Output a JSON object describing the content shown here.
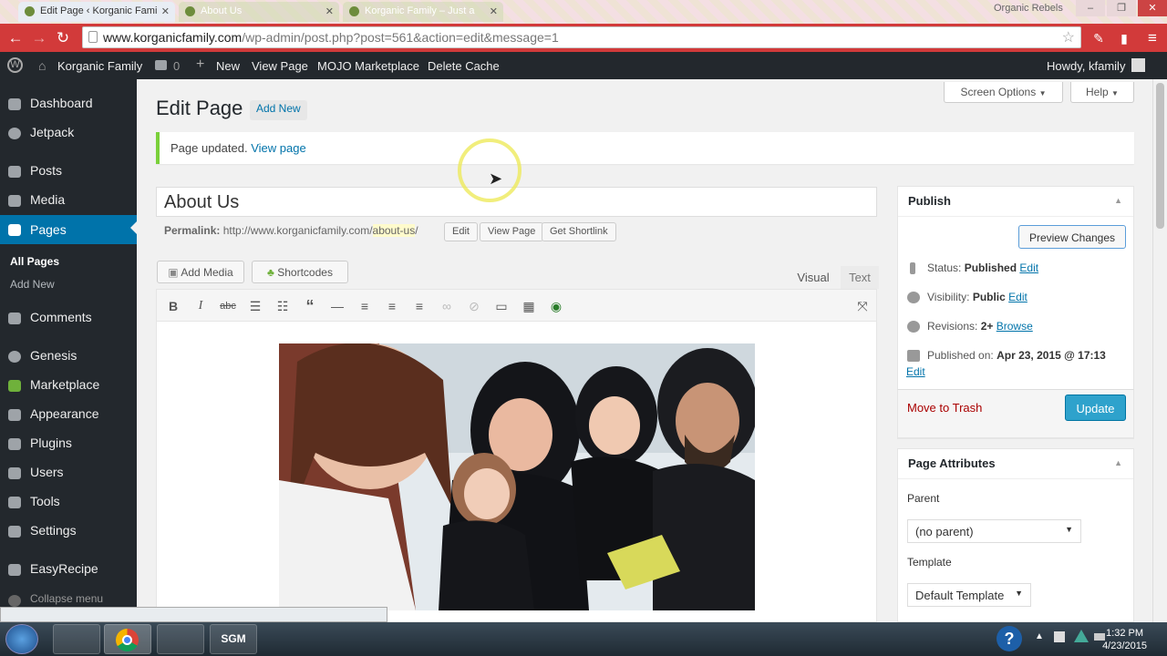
{
  "browser": {
    "tabs": [
      {
        "title": "Edit Page ‹ Korganic Fami",
        "active": true
      },
      {
        "title": "About Us",
        "active": false
      },
      {
        "title": "Korganic Family – Just a",
        "active": false
      }
    ],
    "user_badge": "Organic Rebels",
    "url_host": "www.korganicfamily.com",
    "url_path": "/wp-admin/post.php?post=561&action=edit&message=1"
  },
  "adminbar": {
    "site": "Korganic Family",
    "comments": "0",
    "new": "New",
    "view_page": "View Page",
    "mojo": "MOJO Marketplace",
    "delete_cache": "Delete Cache",
    "howdy": "Howdy, kfamily"
  },
  "sidebar": {
    "items": [
      {
        "label": "Dashboard"
      },
      {
        "label": "Jetpack"
      },
      {
        "label": "Posts"
      },
      {
        "label": "Media"
      },
      {
        "label": "Pages"
      },
      {
        "label": "Comments"
      },
      {
        "label": "Genesis"
      },
      {
        "label": "Marketplace"
      },
      {
        "label": "Appearance"
      },
      {
        "label": "Plugins"
      },
      {
        "label": "Users"
      },
      {
        "label": "Tools"
      },
      {
        "label": "Settings"
      },
      {
        "label": "EasyRecipe"
      }
    ],
    "sub_all": "All Pages",
    "sub_add": "Add New",
    "collapse": "Collapse menu"
  },
  "page": {
    "heading": "Edit Page",
    "add_new": "Add New",
    "screen_options": "Screen Options",
    "help": "Help",
    "notice_text": "Page updated.",
    "notice_link": "View page",
    "post_title": "About Us",
    "permalink_label": "Permalink:",
    "permalink_base": "http://www.korganicfamily.com/",
    "permalink_slug": "about-us",
    "permalink_end": "/",
    "edit_btn": "Edit",
    "view_page_btn": "View Page",
    "shortlink_btn": "Get Shortlink",
    "add_media": "Add Media",
    "shortcodes": "Shortcodes",
    "tab_visual": "Visual",
    "tab_text": "Text"
  },
  "publish": {
    "title": "Publish",
    "preview": "Preview Changes",
    "status_label": "Status:",
    "status_value": "Published",
    "visibility_label": "Visibility:",
    "visibility_value": "Public",
    "revisions_label": "Revisions:",
    "revisions_value": "2+",
    "browse": "Browse",
    "published_label": "Published on:",
    "published_value": "Apr 23, 2015 @ 17:13",
    "edit": "Edit",
    "trash": "Move to Trash",
    "update": "Update"
  },
  "attributes": {
    "title": "Page Attributes",
    "parent_label": "Parent",
    "parent_value": "(no parent)",
    "template_label": "Template",
    "template_value": "Default Template"
  },
  "taskbar": {
    "time": "1:32 PM",
    "date": "4/23/2015",
    "sgm": "SGM"
  },
  "colors": {
    "wp_dark": "#23282d",
    "wp_blue": "#0073aa",
    "update_blue": "#2ea2cc",
    "chrome_red": "#d23a3a",
    "notice_green": "#7ad03a"
  }
}
